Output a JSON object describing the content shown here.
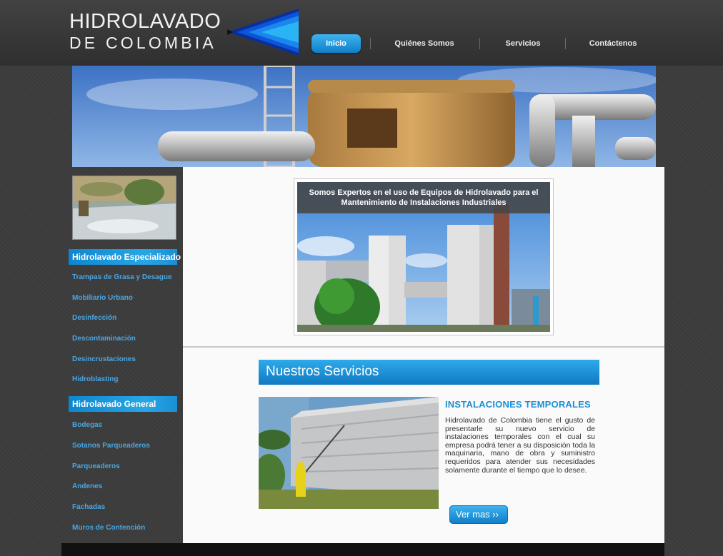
{
  "brand": {
    "name_line1": "HIDROLAVADO",
    "name_line2": "DE COLOMBIA",
    "accent_color": "#1a8fd6"
  },
  "nav": {
    "items": [
      {
        "label": "Inicio",
        "active": true
      },
      {
        "label": "Quiénes Somos",
        "active": false
      },
      {
        "label": "Servicios",
        "active": false
      },
      {
        "label": "Contáctenos",
        "active": false
      }
    ]
  },
  "sidebar": {
    "sections": [
      {
        "title": "Hidrolavado Especializado",
        "links": [
          "Trampas de Grasa y Desague",
          "Mobiliario Urbano",
          "Desinfección",
          "Descontaminación",
          "Desincrustaciones",
          "Hidroblasting"
        ]
      },
      {
        "title": "Hidrolavado General",
        "links": [
          "Bodegas",
          "Sotanos Parqueaderos",
          "Parqueaderos",
          "Andenes",
          "Fachadas",
          "Muros de Contención"
        ]
      }
    ]
  },
  "feature": {
    "caption_line1": "Somos Expertos en el uso de Equipos de Hidrolavado para el",
    "caption_line2": "Mantenimiento de Instalaciones Industriales"
  },
  "services": {
    "heading": "Nuestros Servicios",
    "item_title": "INSTALACIONES TEMPORALES",
    "item_text": "Hidrolavado de Colombia tiene el gusto de presentarle su nuevo servicio de instalaciones temporales con el cual su empresa podrá tener a su disposición toda la maquinaria, mano de obra y suministro requeridos para atender sus necesidades solamente durante el tiempo que lo desee.",
    "more_label": "Ver mas ››"
  }
}
